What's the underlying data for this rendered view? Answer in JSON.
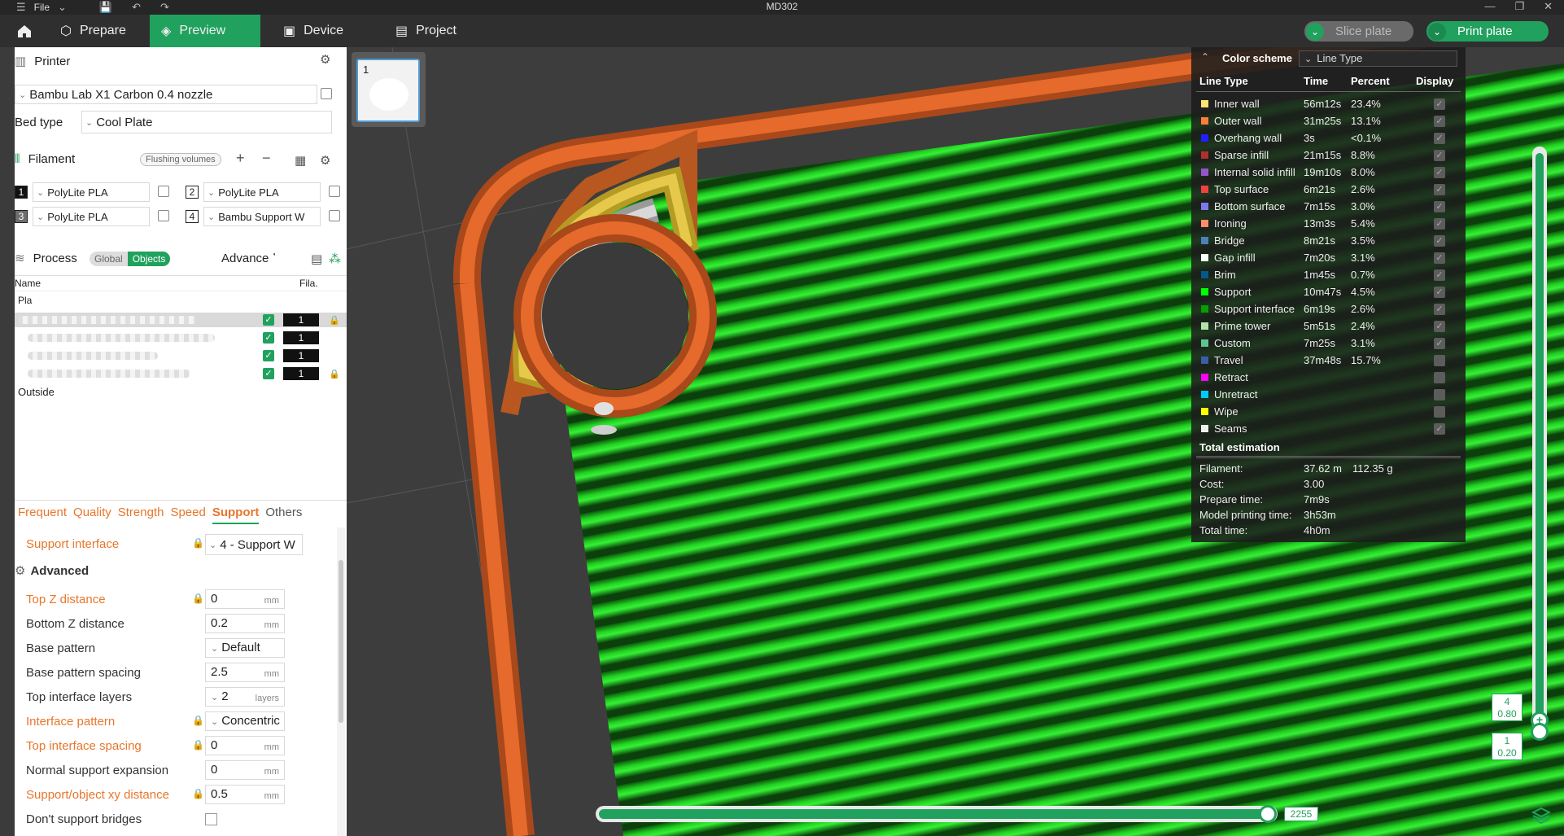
{
  "titlebar": {
    "file_label": "File",
    "title": "MD302"
  },
  "tabs": {
    "prepare": "Prepare",
    "preview": "Preview",
    "device": "Device",
    "project": "Project"
  },
  "actions": {
    "slice": "Slice plate",
    "print": "Print plate"
  },
  "printer": {
    "header": "Printer",
    "name": "Bambu Lab X1 Carbon 0.4 nozzle",
    "bed_type_label": "Bed type",
    "bed_type": "Cool Plate"
  },
  "filament": {
    "header": "Filament",
    "flushing": "Flushing volumes",
    "slots": [
      {
        "num": "1",
        "name": "PolyLite PLA",
        "color": "#111111"
      },
      {
        "num": "2",
        "name": "PolyLite PLA",
        "color": "#ffffff"
      },
      {
        "num": "3",
        "name": "PolyLite PLA",
        "color": "#6e6e6e"
      },
      {
        "num": "4",
        "name": "Bambu Support W",
        "color": "#ffffff"
      }
    ]
  },
  "process": {
    "header": "Process",
    "global": "Global",
    "objects": "Objects",
    "advanced": "Advanced",
    "col_name": "Name",
    "col_fila": "Fila.",
    "plate_label": "Pla",
    "rows": [
      {
        "fila": "1"
      },
      {
        "fila": "1"
      },
      {
        "fila": "1"
      },
      {
        "fila": "1"
      }
    ],
    "outside": "Outside"
  },
  "settings": {
    "tabs": [
      "Frequent",
      "Quality",
      "Strength",
      "Speed",
      "Support",
      "Others"
    ],
    "support_interface_label": "Support interface",
    "support_interface_value": "4 - Support W",
    "advanced_header": "Advanced",
    "rows": [
      {
        "label": "Top Z distance",
        "value": "0",
        "unit": "mm"
      },
      {
        "label": "Bottom Z distance",
        "value": "0.2",
        "unit": "mm"
      },
      {
        "label": "Base pattern",
        "value": "Default",
        "unit": ""
      },
      {
        "label": "Base pattern spacing",
        "value": "2.5",
        "unit": "mm"
      },
      {
        "label": "Top interface layers",
        "value": "2",
        "unit": "layers"
      },
      {
        "label": "Interface pattern",
        "value": "Concentric",
        "unit": ""
      },
      {
        "label": "Top interface spacing",
        "value": "0",
        "unit": "mm"
      },
      {
        "label": "Normal support expansion",
        "value": "0",
        "unit": "mm"
      },
      {
        "label": "Support/object xy distance",
        "value": "0.5",
        "unit": "mm"
      },
      {
        "label": "Don't support bridges",
        "value": "",
        "unit": ""
      }
    ]
  },
  "plate_thumb": {
    "num": "1"
  },
  "legend": {
    "title": "Color scheme",
    "scheme": "Line Type",
    "col_type": "Line Type",
    "col_time": "Time",
    "col_percent": "Percent",
    "col_display": "Display",
    "items": [
      {
        "name": "Inner wall",
        "time": "56m12s",
        "percent": "23.4%",
        "color": "#ffe36e",
        "display": true
      },
      {
        "name": "Outer wall",
        "time": "31m25s",
        "percent": "13.1%",
        "color": "#ff7d38",
        "display": true
      },
      {
        "name": "Overhang wall",
        "time": "3s",
        "percent": "<0.1%",
        "color": "#1f1fff",
        "display": true
      },
      {
        "name": "Sparse infill",
        "time": "21m15s",
        "percent": "8.8%",
        "color": "#b03029",
        "display": true
      },
      {
        "name": "Internal solid infill",
        "time": "19m10s",
        "percent": "8.0%",
        "color": "#9654cc",
        "display": true
      },
      {
        "name": "Top surface",
        "time": "6m21s",
        "percent": "2.6%",
        "color": "#f04040",
        "display": true
      },
      {
        "name": "Bottom surface",
        "time": "7m15s",
        "percent": "3.0%",
        "color": "#7d79e8",
        "display": true
      },
      {
        "name": "Ironing",
        "time": "13m3s",
        "percent": "5.4%",
        "color": "#ff8c69",
        "display": true
      },
      {
        "name": "Bridge",
        "time": "8m21s",
        "percent": "3.5%",
        "color": "#4d80ba",
        "display": true
      },
      {
        "name": "Gap infill",
        "time": "7m20s",
        "percent": "3.1%",
        "color": "#ffffff",
        "display": true
      },
      {
        "name": "Brim",
        "time": "1m45s",
        "percent": "0.7%",
        "color": "#00598a",
        "display": true
      },
      {
        "name": "Support",
        "time": "10m47s",
        "percent": "4.5%",
        "color": "#00ff00",
        "display": true
      },
      {
        "name": "Support interface",
        "time": "6m19s",
        "percent": "2.6%",
        "color": "#00a000",
        "display": true
      },
      {
        "name": "Prime tower",
        "time": "5m51s",
        "percent": "2.4%",
        "color": "#b3e3ab",
        "display": true
      },
      {
        "name": "Custom",
        "time": "7m25s",
        "percent": "3.1%",
        "color": "#5ec48f",
        "display": true
      },
      {
        "name": "Travel",
        "time": "37m48s",
        "percent": "15.7%",
        "color": "#385ea8",
        "display": false
      },
      {
        "name": "Retract",
        "time": "",
        "percent": "",
        "color": "#ff00ff",
        "display": false
      },
      {
        "name": "Unretract",
        "time": "",
        "percent": "",
        "color": "#00c8ff",
        "display": false
      },
      {
        "name": "Wipe",
        "time": "",
        "percent": "",
        "color": "#ffff00",
        "display": false
      },
      {
        "name": "Seams",
        "time": "",
        "percent": "",
        "color": "#f0f0f0",
        "display": true
      }
    ],
    "estimation_title": "Total estimation",
    "estimation": {
      "filament_label": "Filament:",
      "filament_len": "37.62 m",
      "filament_weight": "112.35 g",
      "cost_label": "Cost:",
      "cost": "3.00",
      "prepare_label": "Prepare time:",
      "prepare": "7m9s",
      "model_label": "Model printing time:",
      "model": "3h53m",
      "total_label": "Total time:",
      "total": "4h0m"
    }
  },
  "layer_slider": {
    "top_layer": "4",
    "top_height": "0.80",
    "bottom_layer": "1",
    "bottom_height": "0.20"
  },
  "move_slider": {
    "value": "2255"
  }
}
